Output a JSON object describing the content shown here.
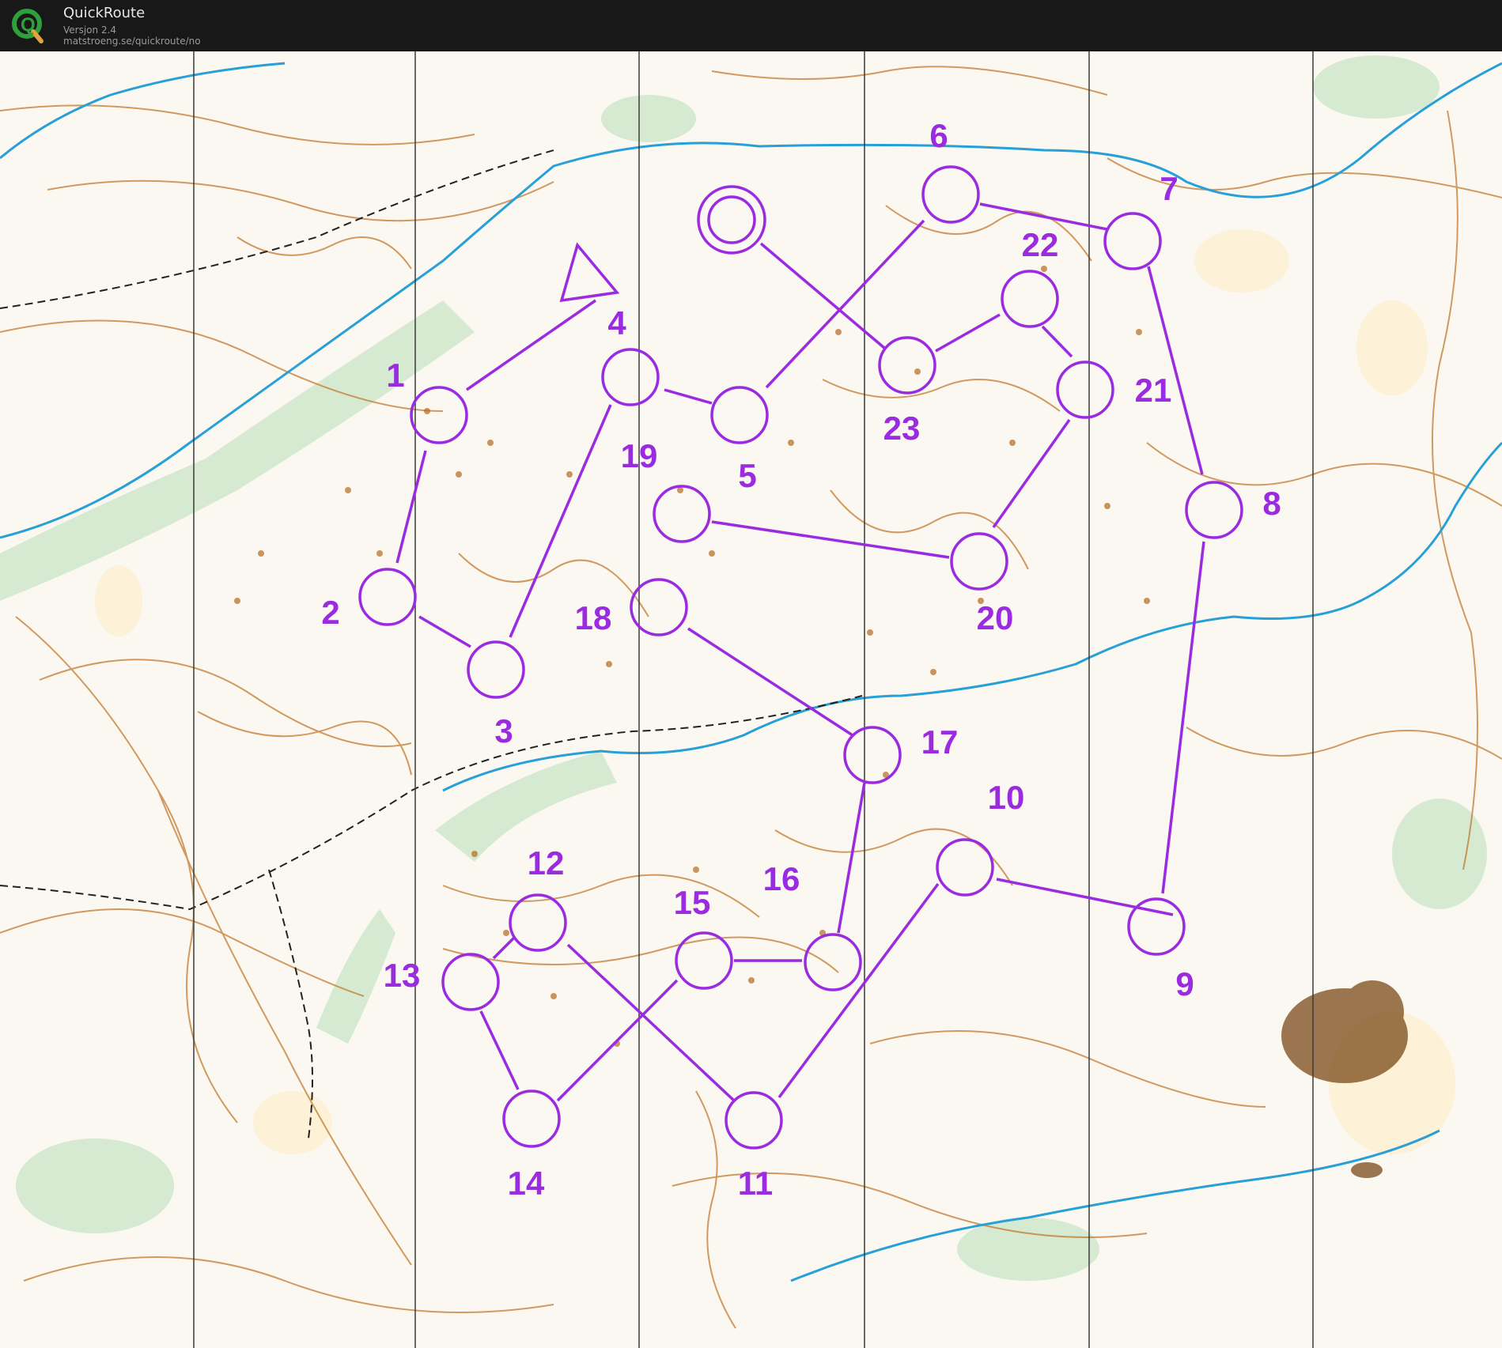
{
  "app": {
    "title": "QuickRoute",
    "version": "Versjon 2.4",
    "url": "matstroeng.se/quickroute/no"
  },
  "map": {
    "course_color": "#9a2be0",
    "controls": [
      {
        "label": "1"
      },
      {
        "label": "2"
      },
      {
        "label": "3"
      },
      {
        "label": "4"
      },
      {
        "label": "5"
      },
      {
        "label": "6"
      },
      {
        "label": "7"
      },
      {
        "label": "8"
      },
      {
        "label": "9"
      },
      {
        "label": "10"
      },
      {
        "label": "11"
      },
      {
        "label": "12"
      },
      {
        "label": "13"
      },
      {
        "label": "14"
      },
      {
        "label": "15"
      },
      {
        "label": "16"
      },
      {
        "label": "17"
      },
      {
        "label": "18"
      },
      {
        "label": "19"
      },
      {
        "label": "20"
      },
      {
        "label": "21"
      },
      {
        "label": "22"
      },
      {
        "label": "23"
      }
    ]
  }
}
